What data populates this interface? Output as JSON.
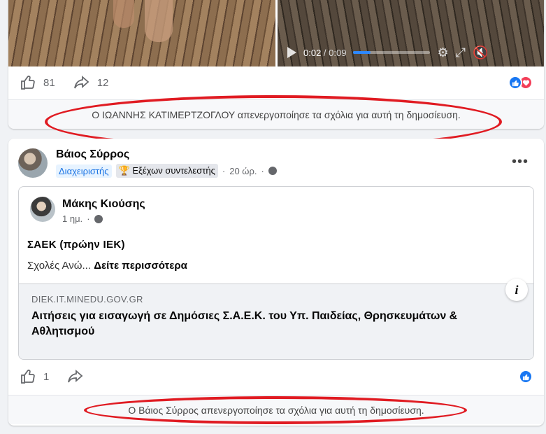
{
  "post1": {
    "video": {
      "time_current": "0:02",
      "time_separator": " / ",
      "time_total": "0:09",
      "progress_fraction": 0.22
    },
    "likes": "81",
    "shares": "12",
    "disabled_notice": "Ο ΙΩΑΝΝΗΣ ΚΑΤΙΜΕΡΤΖΟΓΛΟΥ απενεργοποίησε τα σχόλια για αυτή τη δημοσίευση."
  },
  "post2": {
    "author": "Βάιος Σύρρος",
    "badge_admin": "Διαχειριστής",
    "badge_contributor": "🏆 Εξέχων συντελεστής",
    "separator": "·",
    "time": "20 ώρ.",
    "more_label": "•••",
    "shared": {
      "author": "Μάκης Κιούσης",
      "time": "1 ημ.",
      "title": "ΣΑΕΚ  (πρώην ΙΕΚ)",
      "text": "Σχολές Ανώ...",
      "see_more": "Δείτε περισσότερα",
      "link_domain": "DIEK.IT.MINEDU.GOV.GR",
      "link_title": "Αιτήσεις για εισαγωγή σε Δημόσιες Σ.Α.Ε.Κ. του Υπ. Παιδείας, Θρησκευμάτων & Αθλητισμού",
      "info_label": "i"
    },
    "likes": "1",
    "disabled_notice": "Ο Βάιος Σύρρος απενεργοποίησε τα σχόλια για αυτή τη δημοσίευση."
  },
  "colors": {
    "facebook_blue": "#1877f2",
    "love_red": "#f33e58",
    "annotation_red": "#e01b22"
  }
}
